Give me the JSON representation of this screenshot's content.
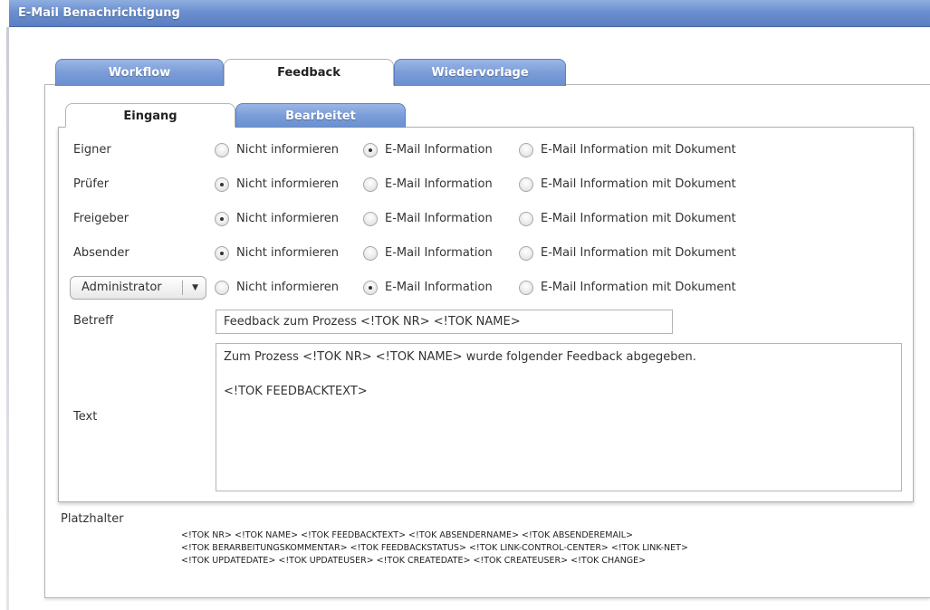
{
  "window": {
    "title": "E-Mail Benachrichtigung"
  },
  "outer_tabs": [
    {
      "label": "Workflow",
      "active": false
    },
    {
      "label": "Feedback",
      "active": true
    },
    {
      "label": "Wiedervorlage",
      "active": false
    }
  ],
  "inner_tabs": [
    {
      "label": "Eingang",
      "active": true
    },
    {
      "label": "Bearbeitet",
      "active": false
    }
  ],
  "options": [
    "Nicht informieren",
    "E-Mail Information",
    "E-Mail Information mit Dokument"
  ],
  "rows": [
    {
      "label": "Eigner",
      "selected": "E-Mail Information"
    },
    {
      "label": "Prüfer",
      "selected": "Nicht informieren"
    },
    {
      "label": "Freigeber",
      "selected": "Nicht informieren"
    },
    {
      "label": "Absender",
      "selected": "Nicht informieren"
    },
    {
      "label": "Administrator",
      "selected": "E-Mail Information",
      "is_dropdown": true
    }
  ],
  "betreff": {
    "label": "Betreff",
    "value": "Feedback zum Prozess <!TOK NR> <!TOK NAME>"
  },
  "text": {
    "label": "Text",
    "value": "Zum Prozess <!TOK NR> <!TOK NAME> wurde folgender Feedback abgegeben.\n\n<!TOK FEEDBACKTEXT>"
  },
  "placeholders": {
    "label": "Platzhalter",
    "lines": [
      "<!TOK NR> <!TOK NAME> <!TOK FEEDBACKTEXT> <!TOK ABSENDERNAME> <!TOK ABSENDEREMAIL>",
      "<!TOK BERARBEITUNGSKOMMENTAR> <!TOK FEEDBACKSTATUS> <!TOK LINK-CONTROL-CENTER> <!TOK LINK-NET>",
      "<!TOK UPDATEDATE> <!TOK UPDATEUSER> <!TOK CREATEDATE> <!TOK CREATEUSER> <!TOK CHANGE>"
    ]
  }
}
